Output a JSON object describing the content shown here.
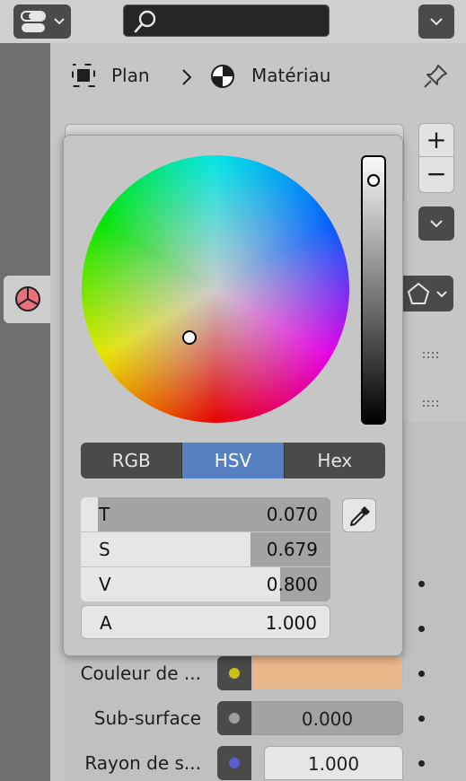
{
  "header": {
    "search_placeholder": "",
    "editor_type_icon": "editor-type-icon",
    "menu_icon": "chevron-down-icon"
  },
  "breadcrumb": {
    "object_label": "Plan",
    "separator": "›",
    "material_label": "Matériau"
  },
  "side_buttons": {
    "add_label": "+",
    "remove_label": "−"
  },
  "color_picker": {
    "modes": [
      "RGB",
      "HSV",
      "Hex"
    ],
    "active_mode": "HSV",
    "fields": [
      {
        "name": "T",
        "value": "0.070",
        "fill": 0.07
      },
      {
        "name": "S",
        "value": "0.679",
        "fill": 0.679
      },
      {
        "name": "V",
        "value": "0.800",
        "fill": 0.8
      },
      {
        "name": "A",
        "value": "1.000",
        "fill": 1.0
      }
    ],
    "value_level": 0.9
  },
  "properties": [
    {
      "label": "Couleur de ...",
      "value": "",
      "socket_color": "#c7c218",
      "field_color": "#e9b88b"
    },
    {
      "label": "Sub-surface",
      "value": "0.000",
      "socket_color": "#9e9e9e",
      "field_color": "#a3a3a3"
    },
    {
      "label": "Rayon de s...",
      "value": "1.000",
      "socket_color": "#5b5bd2",
      "field_color": "#e6e6e6"
    }
  ],
  "colors": {
    "accent": "#5680c2",
    "base_color_swatch": "#e9b88b",
    "material_tab_icon": "#e8707a"
  }
}
